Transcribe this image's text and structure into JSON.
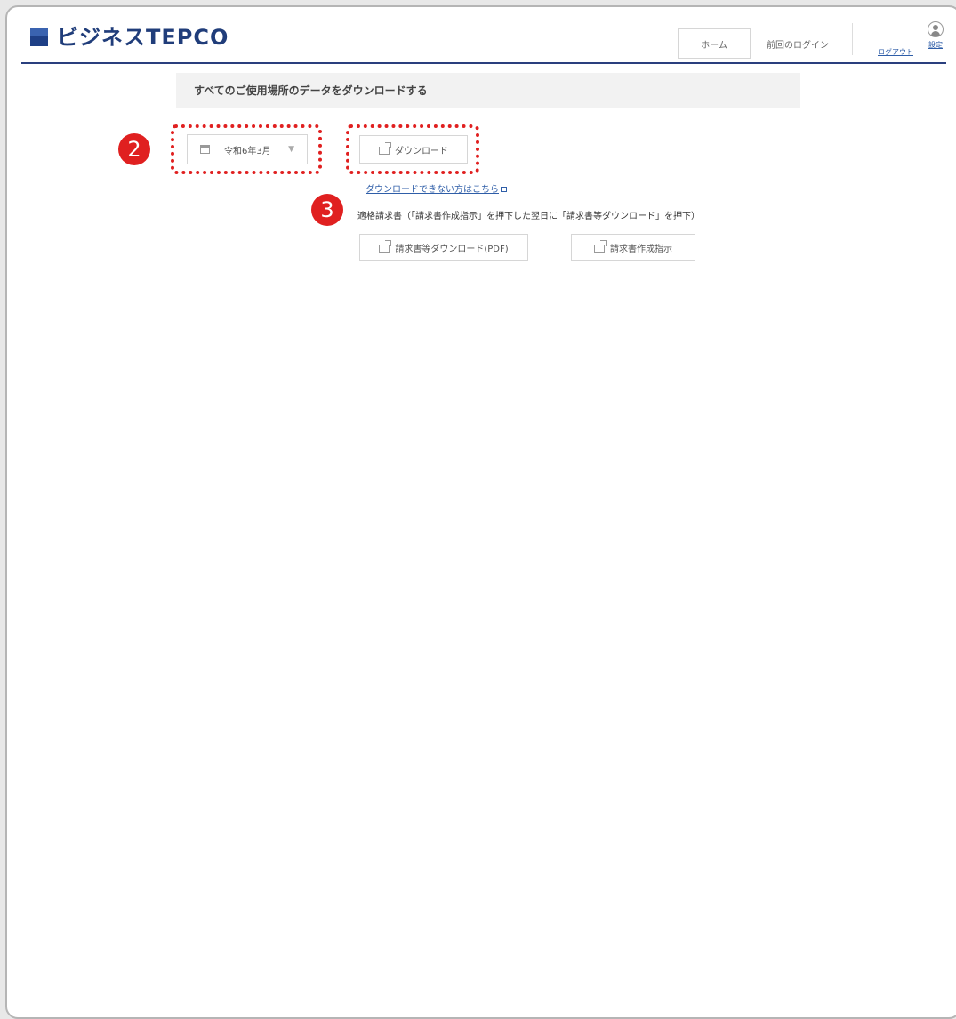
{
  "header": {
    "logo_text": "ビジネスTEPCO",
    "home_label": "ホーム",
    "last_login_label": "前回のログイン",
    "logout_label": "ログアウト",
    "settings_label": "設定"
  },
  "section": {
    "title": "すべてのご使用場所のデータをダウンロードする"
  },
  "controls": {
    "month_selected": "令和6年3月",
    "download_label": "ダウンロード",
    "help_link": "ダウンロードできない方はこちら"
  },
  "invoice": {
    "note": "適格請求書（「請求書作成指示」を押下した翌日に「請求書等ダウンロード」を押下）",
    "download_pdf_label": "請求書等ダウンロード(PDF)",
    "create_label": "請求書作成指示"
  },
  "annotations": {
    "badge_2": "2",
    "badge_3": "3"
  },
  "colors": {
    "brand": "#203d7a",
    "annotation": "#e02020",
    "link": "#2f5ea8"
  }
}
